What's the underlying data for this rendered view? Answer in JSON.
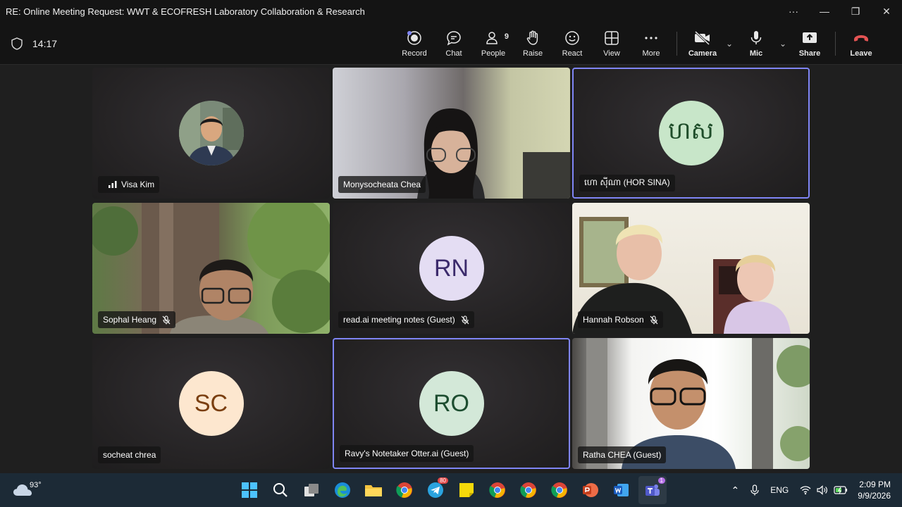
{
  "window": {
    "title": "RE: Online Meeting Request: WWT & ECOFRESH Laboratory Collaboration & Research"
  },
  "meeting": {
    "timer": "14:17"
  },
  "toolbar": {
    "record": "Record",
    "chat": "Chat",
    "people": "People",
    "people_count": "9",
    "raise": "Raise",
    "react": "React",
    "view": "View",
    "more": "More",
    "camera": "Camera",
    "mic": "Mic",
    "share": "Share",
    "leave": "Leave"
  },
  "participants": [
    {
      "name": "Visa Kim"
    },
    {
      "name": "Monysocheata Chea"
    },
    {
      "name": "ហោ ស៊ីណា (HOR SINA)",
      "initials": "ហស"
    },
    {
      "name": "Sophal Heang"
    },
    {
      "name": "read.ai meeting notes (Guest)",
      "initials": "RN"
    },
    {
      "name": "Hannah Robson"
    },
    {
      "name": "socheat chrea",
      "initials": "SC"
    },
    {
      "name": "Ravy's Notetaker Otter.ai (Guest)",
      "initials": "RO"
    },
    {
      "name": "Ratha CHEA (Guest)"
    }
  ],
  "taskbar": {
    "weather_temp": "93°",
    "telegram_badge": "80",
    "teams_badge": "1",
    "language": "ENG",
    "time": "2:09 PM",
    "date": "9/9/2026"
  },
  "colors": {
    "accent": "#7f85f5",
    "leave": "#e45454"
  }
}
